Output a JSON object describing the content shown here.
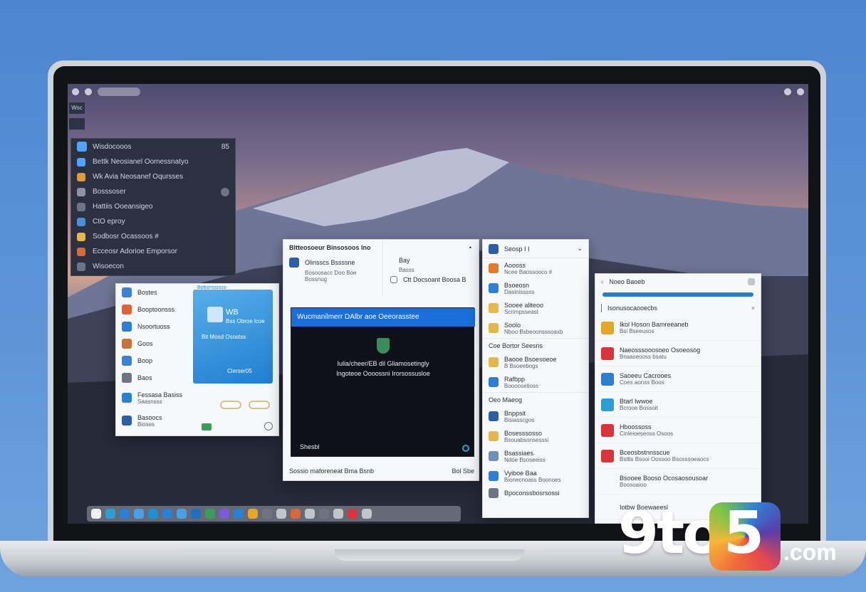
{
  "topbar": {
    "left_badge": "Wsc",
    "right_icon": "settings-icon"
  },
  "dark_panel": {
    "title": "Wisdocooos",
    "badge": "85",
    "items": [
      {
        "label": "Bettk Neosianel Oomessnatyo",
        "color": "#4fa3ff"
      },
      {
        "label": "Wk Avia Neosanef Oqursses",
        "color": "#e09a3a"
      },
      {
        "label": "Bosssoser",
        "color": "#8c93a5"
      },
      {
        "label": "Hattiis Ooeansigeo",
        "color": "#6d7486"
      },
      {
        "label": "CtO eproy",
        "color": "#4c8fd8"
      },
      {
        "label": "Sodbosr Ocassoos #",
        "color": "#e6b84a"
      },
      {
        "label": "Ecceosr Adorioe Emporsor",
        "color": "#d86a3a"
      },
      {
        "label": "Wisoecon",
        "color": "#6d7486"
      }
    ]
  },
  "window_a": {
    "rows": [
      {
        "label": "Bostes",
        "color": "#3b82d6"
      },
      {
        "label": "Booptoonsss",
        "color": "#e06336"
      },
      {
        "label": "Nsoortuoss",
        "color": "#2b7fd4"
      },
      {
        "label": "Goos",
        "color": "#c9733a"
      },
      {
        "label": "Boop",
        "color": "#3b82d6"
      },
      {
        "label": "Baos",
        "color": "#6d7486"
      },
      {
        "label": "Fessasa Basiss",
        "sub": "Saasnsss",
        "color": "#2b7fd4"
      },
      {
        "label": "Basoocs",
        "sub": "Bioses",
        "color": "#2c5fa8"
      }
    ],
    "card_header": "Bohsrrosisss",
    "card_title": "WB",
    "card_sub": "Bss Obroe lcoe",
    "card_line": "Bit Mosd Osostss",
    "card_footer": "Clerser05"
  },
  "window_b": {
    "top_left_title": "Bltteosoeur Binsosoos Ino",
    "top_left_sub": "Olinsscs Bssssne",
    "top_left_line": "Bosoosacc Doo Boe Bossnug",
    "top_right_title": "Bay",
    "top_right_sub": "Basss",
    "top_right_line": "Ctt Docsoant Boosa B",
    "video_title": "Wucmanilmerr DAlbr aoe Oeeorasstee",
    "video_caption_1": "Iulia/cheer/EB dil Gliamosetingly",
    "video_caption_2": "Ingoteoe Oooossni Irorsossusloe",
    "video_footer": "Shesbl",
    "bottom_text": "Sossio maforeneat Bma Bsnb",
    "bottom_right": "Bol  Sbe"
  },
  "window_c": {
    "header": "Seosp I I",
    "sections": [
      {
        "label": "Aoooss",
        "sub": "Ncee Baossooco #",
        "color": "#e67a2b"
      },
      {
        "label": "Bsoeosn",
        "sub": "Dasinisssss",
        "color": "#2b7fd4"
      },
      {
        "label": "Sooee aliteoo",
        "sub": "Scrimpsseast",
        "color": "#e6b84a"
      },
      {
        "label": "Soolo",
        "sub": "Nboo Bsbeoonsssoaxb",
        "color": "#e6b84a"
      },
      {
        "label": "Coe Bortor Seesns",
        "sub": "",
        "color": ""
      },
      {
        "label": "Baooe Bsoesoeoe",
        "sub": "B Bsoeebogs",
        "color": "#e6b84a"
      },
      {
        "label": "Rafbpp",
        "sub": "Boooosetioss",
        "color": "#2b7fd4"
      },
      {
        "label": "Oeo Maeog",
        "sub": "",
        "color": ""
      },
      {
        "label": "Bnppsit",
        "sub": "Bisiasscgos",
        "color": "#2c5fa8"
      },
      {
        "label": "Bosesssosso",
        "sub": "Bsouabsonsesssi",
        "color": "#e6b84a"
      },
      {
        "label": "Bsassiaes",
        "sub": "Ndoe Bsoseeiss",
        "color": "#6d8fb8"
      },
      {
        "label": "Vyiboe Baa",
        "sub": "Bionecnoass Boonoes",
        "color": "#2b7fd4"
      },
      {
        "label": "Bpoconssbosrsossi",
        "sub": "",
        "color": "#6d7486"
      }
    ]
  },
  "window_d": {
    "header": "Noeo  Baoeb",
    "search_label": "Isonusocaooecbs",
    "items": [
      {
        "label": "Ikol Hoson Bamreeaneb",
        "sub": "Bsi Bseeusos",
        "color": "#e6a52b"
      },
      {
        "label": "Naeosssooosoeo Osoeosog",
        "sub": "Bnaaseooss bsatu",
        "color": "#d8343a"
      },
      {
        "label": "Saoeeu Cacrooes",
        "sub": "Coes aonss Boos",
        "color": "#2b7fd4"
      },
      {
        "label": "Btarl Iwwoe",
        "sub": "Bcrooe Bossoit",
        "color": "#2b9fd4"
      },
      {
        "label": "Hboossoss",
        "sub": "Cinleioeseoss Osoos",
        "color": "#d8343a"
      },
      {
        "label": "Bceosbstnnsscue",
        "sub": "Bsttis Bsooi Oossoo Bsosssoeaocs",
        "color": "#d8343a"
      },
      {
        "label": "Bsooee Booso Ocosaosousoar",
        "sub": "Boosoaioo",
        "color": ""
      },
      {
        "label": "Iotbw Boewaeesl",
        "sub": "",
        "color": ""
      }
    ]
  },
  "dock": {
    "colors": [
      "#f2f2f2",
      "#2b9fd4",
      "#2b7fd4",
      "#4aa0e6",
      "#1f8fd4",
      "#2b7fd4",
      "#4aa0e6",
      "#1f6fc0",
      "#3a9d5a",
      "#7a5ad8",
      "#2b7fd4",
      "#e6a52b",
      "#6d7486",
      "#c0c5cc",
      "#d86a3a",
      "#c0c5cc",
      "#6d7486",
      "#c0c5cc",
      "#d8343a",
      "#c0c5cc"
    ]
  },
  "brand": {
    "nine": "9to",
    "five": "5",
    "dotcom": ".com"
  }
}
